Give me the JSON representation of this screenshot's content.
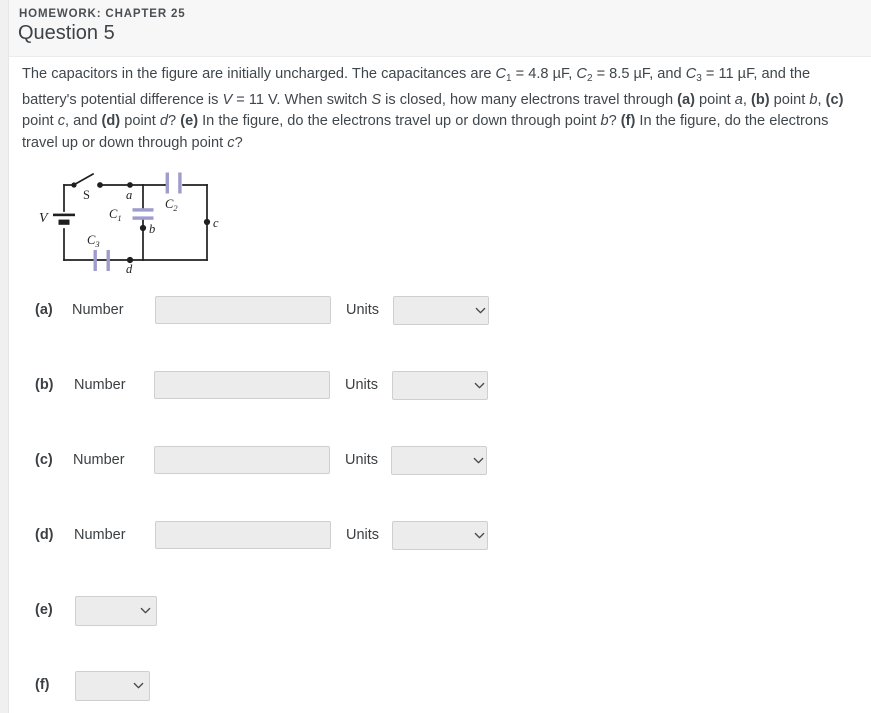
{
  "header": {
    "eyebrow": "HOMEWORK: CHAPTER 25",
    "title": "Question 5"
  },
  "statement": {
    "s1": "The capacitors in the figure are initially uncharged. The capacitances are ",
    "c1_sym": "C",
    "c1_sub": "1",
    "c1_eq": " = 4.8 µF, ",
    "c2_sym": "C",
    "c2_sub": "2",
    "c2_eq": " = 8.5 µF, and ",
    "c3_sym": "C",
    "c3_sub": "3",
    "c3_eq": " = 11 µF, and the battery's potential difference is ",
    "v_sym": "V",
    "v_eq": " = 11 V. When switch ",
    "s_sym": "S",
    "s2": " is closed, how many electrons travel through ",
    "pa": "(a)",
    "pa_txt": " point ",
    "pa_pt": "a",
    "pa_end": ", ",
    "pb": "(b)",
    "pb_txt": " point ",
    "pb_pt": "b",
    "pb_end": ", ",
    "pc": "(c)",
    "pc_txt": " point ",
    "pc_pt": "c",
    "pc_end": ", and ",
    "pd": "(d)",
    "pd_txt": " point ",
    "pd_pt": "d",
    "pd_end": "? ",
    "pe": "(e)",
    "pe_txt": " In the figure, do the electrons travel up or down through point ",
    "pe_pt": "b",
    "pe_end": "? ",
    "pf": "(f)",
    "pf_txt": " In the figure, do the electrons travel up or down through point ",
    "pf_pt": "c",
    "pf_end": "?"
  },
  "figure": {
    "alt": "circuit-diagram",
    "labels": {
      "battery": "V",
      "switch": "S",
      "node_a": "a",
      "node_b": "b",
      "node_c": "c",
      "node_d": "d",
      "cap1": "C",
      "cap1_sub": "1",
      "cap2": "C",
      "cap2_sub": "2",
      "cap3": "C",
      "cap3_sub": "3"
    },
    "colors": {
      "wire": "#1f1f1f",
      "plate": "#9e9ccb"
    }
  },
  "answers": {
    "number_label": "Number",
    "units_label": "Units",
    "rows": [
      {
        "part": "(a)",
        "number_value": "",
        "number_placeholder": "",
        "units_value": "",
        "units_options": [
          ""
        ]
      },
      {
        "part": "(b)",
        "number_value": "",
        "number_placeholder": "",
        "units_value": "",
        "units_options": [
          ""
        ]
      },
      {
        "part": "(c)",
        "number_value": "",
        "number_placeholder": "",
        "units_value": "",
        "units_options": [
          ""
        ]
      },
      {
        "part": "(d)",
        "number_value": "",
        "number_placeholder": "",
        "units_value": "",
        "units_options": [
          ""
        ]
      }
    ],
    "choice_rows": [
      {
        "part": "(e)",
        "value": "",
        "options": [
          ""
        ]
      },
      {
        "part": "(f)",
        "value": "",
        "options": [
          ""
        ]
      }
    ]
  },
  "icons": {
    "chevron_down": "chevron-down-icon"
  }
}
